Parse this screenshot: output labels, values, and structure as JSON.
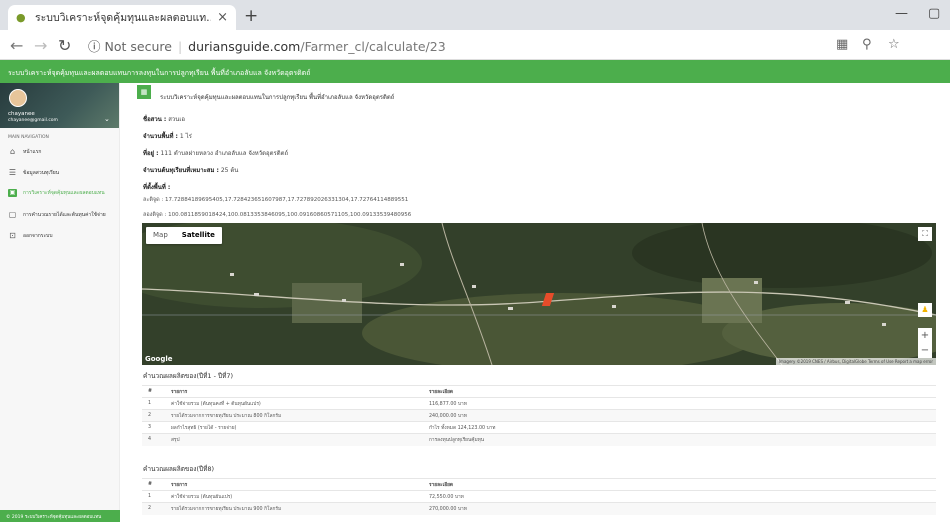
{
  "browser": {
    "tab_title": "ระบบวิเคราะห์จุดคุ้มทุนและผลตอบแท…",
    "tab_close": "×",
    "new_tab": "+",
    "url_icon": "ⓘ",
    "url_security": "Not secure",
    "url_domain": "duriansguide.com",
    "url_path": "/Farmer_cl/calculate/23",
    "minimize": "—",
    "restore": "▢"
  },
  "banner": "ระบบวิเคราะห์จุดคุ้มทุนและผลตอบแทนการลงทุนในการปลูกทุเรียน พื้นที่อำเภอลับแล จังหวัดอุตรดิตถ์",
  "sidebar": {
    "username": "chayanee",
    "email": "chayanee@gmail.com",
    "header": "MAIN NAVIGATION",
    "items": [
      {
        "label": "หน้าแรก",
        "icon": "home-icon",
        "glyph": "⌂"
      },
      {
        "label": "ข้อมูลสวนทุเรียน",
        "icon": "list-icon",
        "glyph": "☰"
      },
      {
        "label": "การวิเคราะห์จุดคุ้มทุนและผลตอบแทน",
        "icon": "chart-icon",
        "glyph": "▣"
      },
      {
        "label": "การคำนวณรายได้และต้นทุนค่าใช้จ่าย",
        "icon": "calendar-icon",
        "glyph": "▢"
      },
      {
        "label": "ออกจากระบบ",
        "icon": "logout-icon",
        "glyph": "⊡"
      }
    ],
    "footer": "© 2019 ระบบวิเคราะห์จุดคุ้มทุนและผลตอบแทน"
  },
  "card": {
    "icon": "▦",
    "title": "ระบบวิเคราะห์จุดคุ้มทุนและผลตอบแทนในการปลูกทุเรียน พื้นที่อำเภอลับแล จังหวัดอุตรดิตถ์"
  },
  "info": {
    "garden_label": "ชื่อสวน :",
    "garden_value": "สวนเอ",
    "area_label": "จำนวนพื้นที่ :",
    "area_value": "1 ไร่",
    "address_label": "ที่อยู่ :",
    "address_value": "111 ตำบลฝายหลวง อำเภอลับแล จังหวัดอุตรดิตถ์",
    "trees_label": "จำนวนต้นทุเรียนที่เหมาะสม :",
    "trees_value": "25 ต้น",
    "location_label": "ที่ตั้งพื้นที่ :",
    "lat_label": "ละติจูด :",
    "lat_value": "17.72884189695405,17.728423651607987,17.727892026331304,17.72764114889551",
    "lng_label": "ลองติจูด :",
    "lng_value": "100.0811859018424,100.0813353846095,100.09160860571105,100.09133539480956"
  },
  "map": {
    "tab_map": "Map",
    "tab_satellite": "Satellite",
    "logo": "Google",
    "attribution": "Imagery ©2019 CNES / Airbus, DigitalGlobe  Terms of Use  Report a map error",
    "zoom_in": "+",
    "zoom_out": "−",
    "fullscreen": "⛶",
    "pegman": "♟"
  },
  "table1": {
    "title": "คำนวณผลผลิตของ(ปีที่1 - ปีที่7)",
    "headers": [
      "#",
      "รายการ",
      "รายละเอียด"
    ],
    "rows": [
      [
        "1",
        "ค่าใช้จ่ายรวม (ต้นทุนคงที่ + ต้นทุนผันแปร)",
        "116,877.00 บาท"
      ],
      [
        "2",
        "รายได้รวมจากการขายทุเรียน ประมาณ 800 กิโลกรัม",
        "240,000.00 บาท"
      ],
      [
        "3",
        "ผลกำไรสุทธิ (รายได้ - รายจ่าย)",
        "กำไร ทั้งหมด 124,123.00 บาท"
      ],
      [
        "4",
        "สรุป",
        "การลงทุนปลูกทุเรียนคุ้มทุน"
      ]
    ]
  },
  "table2": {
    "title": "คำนวณผลผลิตของ(ปีที่8)",
    "headers": [
      "#",
      "รายการ",
      "รายละเอียด"
    ],
    "rows": [
      [
        "1",
        "ค่าใช้จ่ายรวม (ต้นทุนผันแปร)",
        "72,550.00 บาท"
      ],
      [
        "2",
        "รายได้รวมจากการขายทุเรียน ประมาณ 900 กิโลกรัม",
        "270,000.00 บาท"
      ]
    ]
  }
}
